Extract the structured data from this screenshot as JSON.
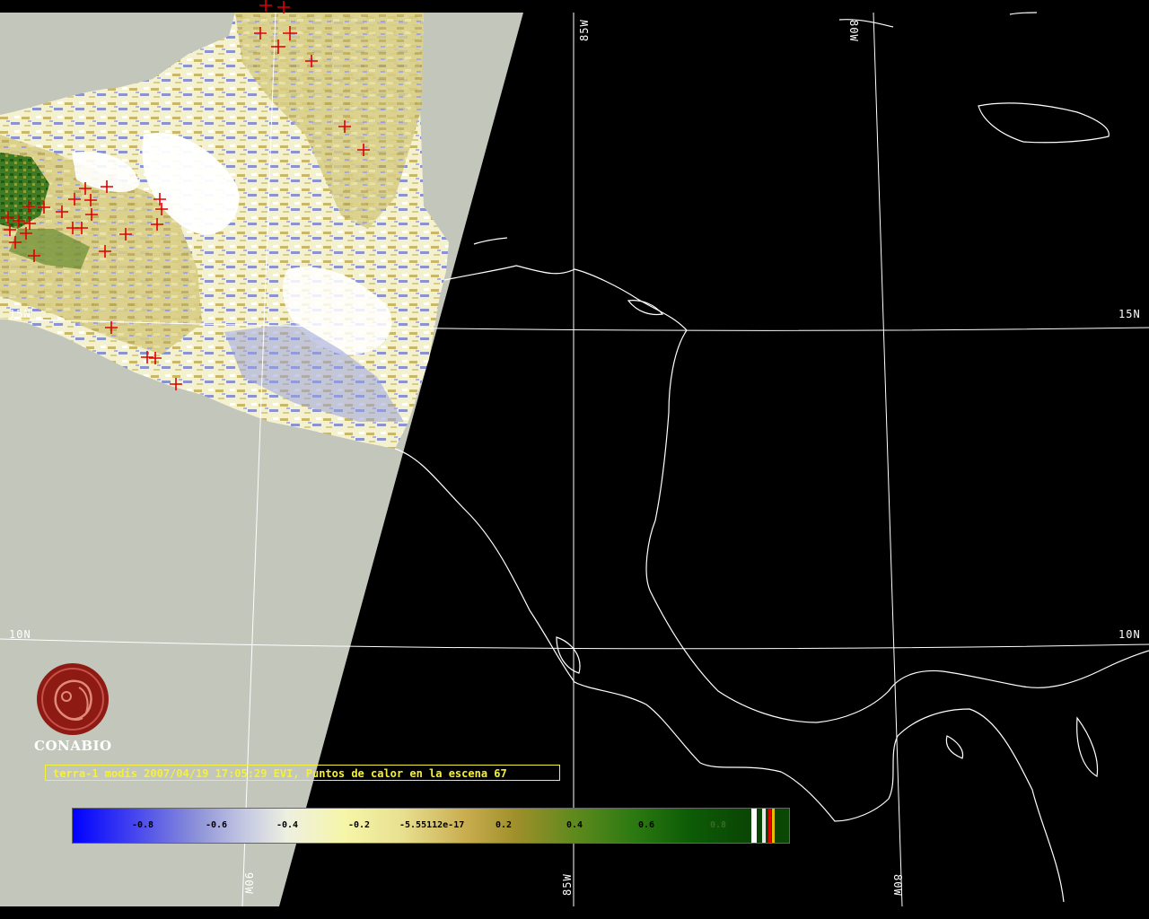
{
  "title": "terra-1 modis 2007/04/19 17:05:29 EVI, Puntos de calor en la escena 67",
  "logo_text": "CONABIO",
  "colorbar_ticks": [
    "-0.8",
    "-0.6",
    "-0.4",
    "-0.2",
    "-5.55112e-17",
    "0.2",
    "0.4",
    "0.6",
    "0.8"
  ],
  "latitude_labels": {
    "n15_left": "15N",
    "n15_right": "15N",
    "n10_left": "10N",
    "n10_right": "10N"
  },
  "longitude_labels": {
    "w85_top": "85W",
    "w80_top": "80W",
    "w90_bottom": "90W",
    "w85_bottom": "85W",
    "w80_bottom": "80W"
  },
  "colors": {
    "background": "#000000",
    "no_data": "#c3c6ba",
    "graticule": "#ffffff",
    "coastline": "#ffffff",
    "hotspot": "#e00000",
    "title_text": "#f5f03a",
    "logo": "#8e1a14"
  },
  "icons": [
    "hotspot-cross-icon",
    "conabio-logo-icon"
  ]
}
